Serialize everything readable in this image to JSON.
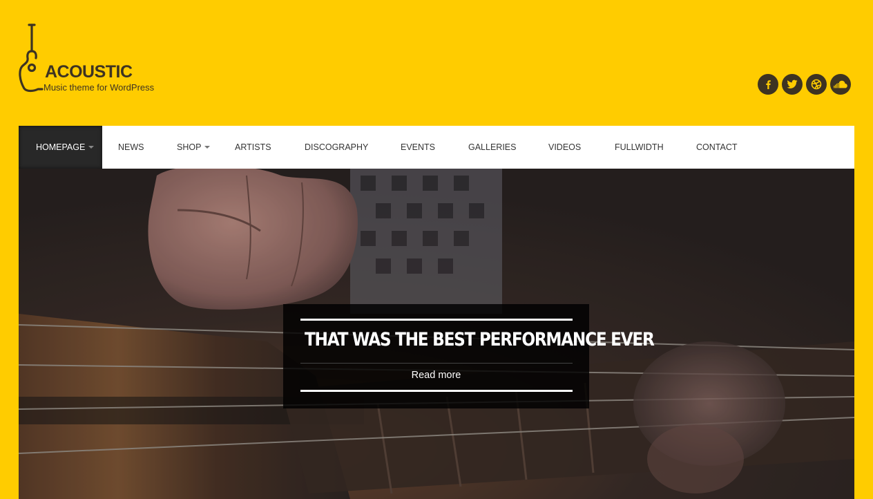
{
  "logo": {
    "title": "ACOUSTIC",
    "tagline": "Music theme for WordPress",
    "icon": "guitar-icon"
  },
  "social": [
    {
      "icon": "facebook-icon",
      "glyph": "f"
    },
    {
      "icon": "twitter-icon",
      "glyph": "t"
    },
    {
      "icon": "dribbble-icon",
      "glyph": "d"
    },
    {
      "icon": "soundcloud-icon",
      "glyph": "s"
    }
  ],
  "nav": {
    "items": [
      {
        "label": "HOMEPAGE",
        "active": true,
        "dropdown": true
      },
      {
        "label": "NEWS"
      },
      {
        "label": "SHOP",
        "dropdown": true
      },
      {
        "label": "ARTISTS"
      },
      {
        "label": "DISCOGRAPHY"
      },
      {
        "label": "EVENTS"
      },
      {
        "label": "GALLERIES"
      },
      {
        "label": "VIDEOS"
      },
      {
        "label": "FULLWIDTH"
      },
      {
        "label": "CONTACT"
      }
    ]
  },
  "slider": {
    "title": "THAT WAS THE BEST PERFORMANCE EVER",
    "link_label": "Read more"
  },
  "colors": {
    "background": "#ffcc00",
    "dark": "#3d3322",
    "nav_active": "#282828"
  }
}
